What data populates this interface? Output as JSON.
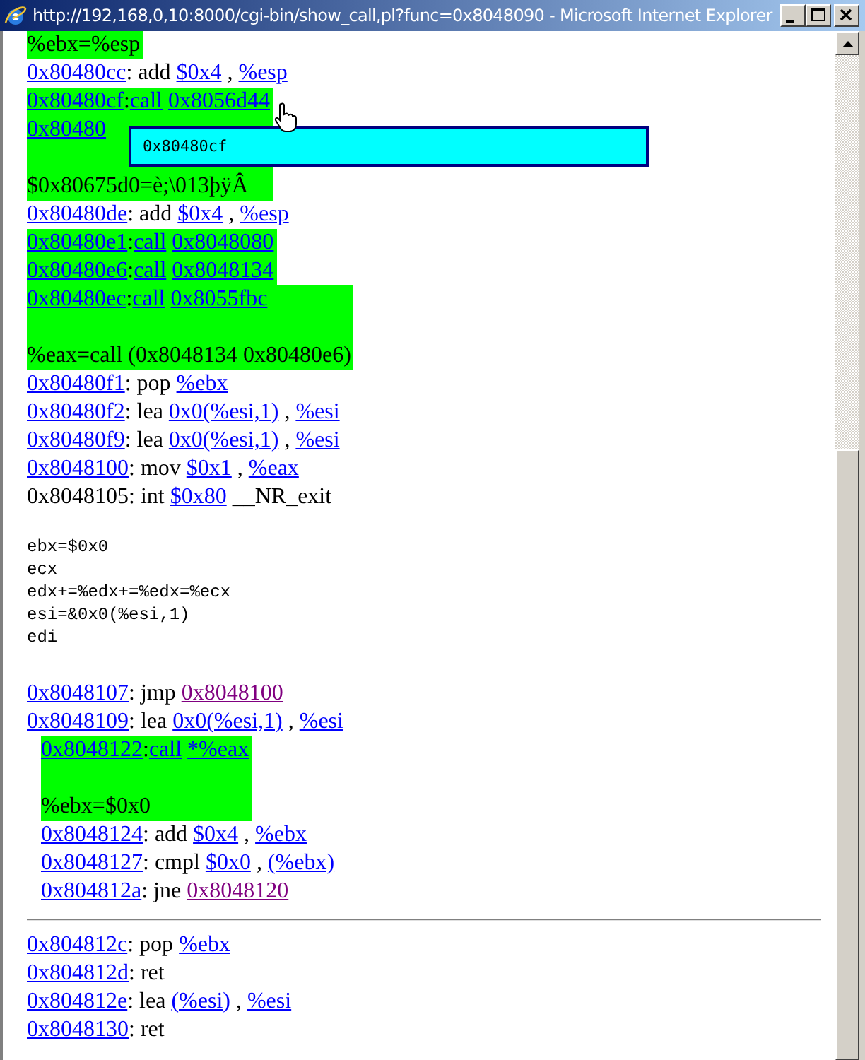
{
  "window": {
    "title": "http://192,168,0,10:8000/cgi-bin/show_call,pl?func=0x8048090 - Microsoft Internet Explorer"
  },
  "items": [
    {
      "kind": "highlight",
      "note": [
        {
          "kind": "text",
          "t": "%ebx=%esp"
        }
      ]
    },
    {
      "kind": "line",
      "segs": [
        {
          "kind": "link",
          "t": "0x80480cc",
          "visited": false
        },
        {
          "kind": "text",
          "t": ": add "
        },
        {
          "kind": "link",
          "t": "$0x4",
          "visited": false
        },
        {
          "kind": "text",
          "t": " , "
        },
        {
          "kind": "link",
          "t": "%esp",
          "visited": false
        }
      ]
    },
    {
      "kind": "highlight",
      "calls": [
        [
          {
            "kind": "link",
            "t": "0x80480cf",
            "visited": false
          },
          {
            "kind": "text",
            "t": ":"
          },
          {
            "kind": "link",
            "t": "call",
            "visited": false
          },
          {
            "kind": "link",
            "t": "0x8056d44",
            "visited": false
          }
        ],
        [
          {
            "kind": "link",
            "t": "0x80480",
            "visited": false
          }
        ]
      ],
      "note": [
        {
          "kind": "text",
          "t": "$0x80675d0=è;\\013þÿÂ"
        }
      ]
    },
    {
      "kind": "line",
      "segs": [
        {
          "kind": "link",
          "t": "0x80480de",
          "visited": false
        },
        {
          "kind": "text",
          "t": ": add "
        },
        {
          "kind": "link",
          "t": "$0x4",
          "visited": false
        },
        {
          "kind": "text",
          "t": " , "
        },
        {
          "kind": "link",
          "t": "%esp",
          "visited": false
        }
      ]
    },
    {
      "kind": "highlight",
      "calls": [
        [
          {
            "kind": "link",
            "t": "0x80480e1",
            "visited": false
          },
          {
            "kind": "text",
            "t": ":"
          },
          {
            "kind": "link",
            "t": "call",
            "visited": false
          },
          {
            "kind": "link",
            "t": "0x8048080",
            "visited": false
          }
        ]
      ]
    },
    {
      "kind": "highlight",
      "calls": [
        [
          {
            "kind": "link",
            "t": "0x80480e6",
            "visited": false
          },
          {
            "kind": "text",
            "t": ":"
          },
          {
            "kind": "link",
            "t": "call",
            "visited": false
          },
          {
            "kind": "link",
            "t": "0x8048134",
            "visited": false
          }
        ]
      ]
    },
    {
      "kind": "highlight",
      "calls": [
        [
          {
            "kind": "link",
            "t": "0x80480ec",
            "visited": false
          },
          {
            "kind": "text",
            "t": ":"
          },
          {
            "kind": "link",
            "t": "call",
            "visited": false
          },
          {
            "kind": "link",
            "t": "0x8055fbc",
            "visited": false
          }
        ]
      ],
      "note": [
        {
          "kind": "text",
          "t": "%eax=call (0x8048134 0x80480e6)"
        }
      ]
    },
    {
      "kind": "line",
      "segs": [
        {
          "kind": "link",
          "t": "0x80480f1",
          "visited": false
        },
        {
          "kind": "text",
          "t": ": pop "
        },
        {
          "kind": "link",
          "t": "%ebx",
          "visited": false
        }
      ]
    },
    {
      "kind": "line",
      "segs": [
        {
          "kind": "link",
          "t": "0x80480f2",
          "visited": false
        },
        {
          "kind": "text",
          "t": ": lea "
        },
        {
          "kind": "link",
          "t": "0x0(%esi,1)",
          "visited": false
        },
        {
          "kind": "text",
          "t": " , "
        },
        {
          "kind": "link",
          "t": "%esi",
          "visited": false
        }
      ]
    },
    {
      "kind": "line",
      "segs": [
        {
          "kind": "link",
          "t": "0x80480f9",
          "visited": false
        },
        {
          "kind": "text",
          "t": ": lea "
        },
        {
          "kind": "link",
          "t": "0x0(%esi,1)",
          "visited": false
        },
        {
          "kind": "text",
          "t": " , "
        },
        {
          "kind": "link",
          "t": "%esi",
          "visited": false
        }
      ]
    },
    {
      "kind": "line",
      "segs": [
        {
          "kind": "link",
          "t": "0x8048100",
          "visited": false
        },
        {
          "kind": "text",
          "t": ": mov "
        },
        {
          "kind": "link",
          "t": "$0x1",
          "visited": false
        },
        {
          "kind": "text",
          "t": " , "
        },
        {
          "kind": "link",
          "t": "%eax",
          "visited": false
        }
      ]
    },
    {
      "kind": "line",
      "segs": [
        {
          "kind": "text",
          "t": "0x8048105: int "
        },
        {
          "kind": "link",
          "t": "$0x80",
          "visited": false
        },
        {
          "kind": "text",
          "t": " __NR_exit"
        }
      ]
    },
    {
      "kind": "mono",
      "lines": [
        "ebx=$0x0",
        "ecx",
        "edx+=%edx+=%edx=%ecx",
        "esi=&0x0(%esi,1)",
        "edi"
      ]
    },
    {
      "kind": "line",
      "segs": [
        {
          "kind": "link",
          "t": "0x8048107",
          "visited": false
        },
        {
          "kind": "text",
          "t": ": jmp "
        },
        {
          "kind": "link",
          "t": "0x8048100",
          "visited": true
        }
      ]
    },
    {
      "kind": "line",
      "segs": [
        {
          "kind": "link",
          "t": "0x8048109",
          "visited": false
        },
        {
          "kind": "text",
          "t": ": lea "
        },
        {
          "kind": "link",
          "t": "0x0(%esi,1)",
          "visited": false
        },
        {
          "kind": "text",
          "t": " , "
        },
        {
          "kind": "link",
          "t": "%esi",
          "visited": false
        }
      ]
    },
    {
      "kind": "group",
      "children": [
        {
          "kind": "highlight",
          "calls": [
            [
              {
                "kind": "link",
                "t": "0x8048122",
                "visited": false
              },
              {
                "kind": "text",
                "t": ":"
              },
              {
                "kind": "link",
                "t": "call",
                "visited": false
              },
              {
                "kind": "link",
                "t": "*%eax",
                "visited": false
              }
            ]
          ],
          "note": [
            {
              "kind": "text",
              "t": "%ebx=$0x0"
            }
          ]
        },
        {
          "kind": "line",
          "segs": [
            {
              "kind": "link",
              "t": "0x8048124",
              "visited": false
            },
            {
              "kind": "text",
              "t": ": add "
            },
            {
              "kind": "link",
              "t": "$0x4",
              "visited": false
            },
            {
              "kind": "text",
              "t": " , "
            },
            {
              "kind": "link",
              "t": "%ebx",
              "visited": false
            }
          ]
        },
        {
          "kind": "line",
          "segs": [
            {
              "kind": "link",
              "t": "0x8048127",
              "visited": false
            },
            {
              "kind": "text",
              "t": ": cmpl "
            },
            {
              "kind": "link",
              "t": "$0x0",
              "visited": false
            },
            {
              "kind": "text",
              "t": " , "
            },
            {
              "kind": "link",
              "t": "(%ebx)",
              "visited": false
            }
          ]
        },
        {
          "kind": "line",
          "segs": [
            {
              "kind": "link",
              "t": "0x804812a",
              "visited": false
            },
            {
              "kind": "text",
              "t": ": jne "
            },
            {
              "kind": "link",
              "t": "0x8048120",
              "visited": true
            }
          ]
        }
      ]
    },
    {
      "kind": "rule"
    },
    {
      "kind": "line",
      "segs": [
        {
          "kind": "link",
          "t": "0x804812c",
          "visited": false
        },
        {
          "kind": "text",
          "t": ": pop "
        },
        {
          "kind": "link",
          "t": "%ebx",
          "visited": false
        }
      ]
    },
    {
      "kind": "line",
      "segs": [
        {
          "kind": "link",
          "t": "0x804812d",
          "visited": false
        },
        {
          "kind": "text",
          "t": ": ret"
        }
      ]
    },
    {
      "kind": "line",
      "segs": [
        {
          "kind": "link",
          "t": "0x804812e",
          "visited": false
        },
        {
          "kind": "text",
          "t": ": lea "
        },
        {
          "kind": "link",
          "t": "(%esi)",
          "visited": false
        },
        {
          "kind": "text",
          "t": " , "
        },
        {
          "kind": "link",
          "t": "%esi",
          "visited": false
        }
      ]
    },
    {
      "kind": "line",
      "segs": [
        {
          "kind": "link",
          "t": "0x8048130",
          "visited": false
        },
        {
          "kind": "text",
          "t": ": ret"
        }
      ]
    }
  ],
  "tooltip": {
    "text": "0x80480cf"
  }
}
